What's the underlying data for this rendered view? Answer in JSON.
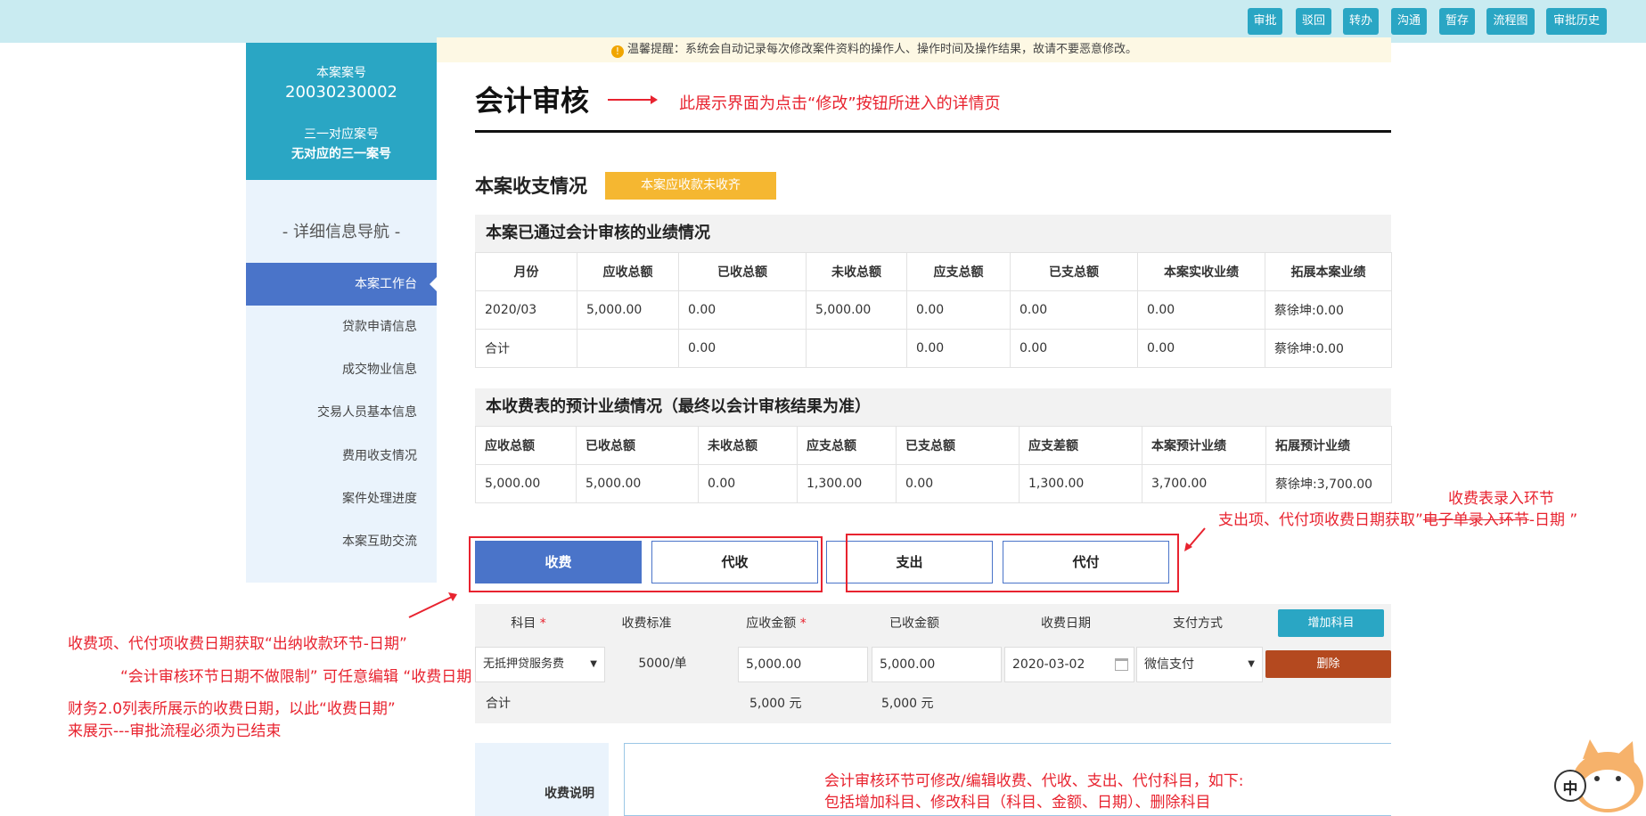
{
  "toolbar": {
    "buttons": [
      "审批",
      "驳回",
      "转办",
      "沟通",
      "暂存",
      "流程图",
      "审批历史"
    ]
  },
  "notice": {
    "icon": "warning-icon",
    "text": "温馨提醒：系统会自动记录每次修改案件资料的操作人、操作时间及操作结果，故请不要恶意修改。"
  },
  "case": {
    "case_no_label": "本案案号",
    "case_no": "20030230002",
    "sanyi_label": "三一对应案号",
    "sanyi_value": "无对应的三一案号"
  },
  "sidebar": {
    "title": "- 详细信息导航 -",
    "items": [
      {
        "label": "本案工作台",
        "active": true
      },
      {
        "label": "贷款申请信息",
        "active": false
      },
      {
        "label": "成交物业信息",
        "active": false
      },
      {
        "label": "交易人员基本信息",
        "active": false
      },
      {
        "label": "费用收支情况",
        "active": false
      },
      {
        "label": "案件处理进度",
        "active": false
      },
      {
        "label": "本案互助交流",
        "active": false
      }
    ]
  },
  "page_title": "会计审核",
  "income_section": {
    "title": "本案收支情况",
    "badge": "本案应收款未收齐"
  },
  "approved_table": {
    "title": "本案已通过会计审核的业绩情况",
    "headers": [
      "月份",
      "应收总额",
      "已收总额",
      "未收总额",
      "应支总额",
      "已支总额",
      "本案实收业绩",
      "拓展本案业绩"
    ],
    "rows": [
      [
        "2020/03",
        "5,000.00",
        "0.00",
        "5,000.00",
        "0.00",
        "0.00",
        "0.00",
        "蔡徐坤:0.00"
      ],
      [
        "合计",
        "",
        "0.00",
        "",
        "0.00",
        "0.00",
        "0.00",
        "蔡徐坤:0.00"
      ]
    ]
  },
  "forecast_table": {
    "title": "本收费表的预计业绩情况（最终以会计审核结果为准）",
    "headers": [
      "应收总额",
      "已收总额",
      "未收总额",
      "应支总额",
      "已支总额",
      "应支差额",
      "本案预计业绩",
      "拓展预计业绩"
    ],
    "rows": [
      [
        "5,000.00",
        "5,000.00",
        "0.00",
        "1,300.00",
        "0.00",
        "1,300.00",
        "3,700.00",
        "蔡徐坤:3,700.00"
      ]
    ]
  },
  "tabs": [
    {
      "label": "收费",
      "active": true
    },
    {
      "label": "代收",
      "active": false
    },
    {
      "label": "支出",
      "active": false
    },
    {
      "label": "代付",
      "active": false
    }
  ],
  "fee_table": {
    "headers": {
      "subject": "科目",
      "standard": "收费标准",
      "receivable": "应收金额",
      "received": "已收金额",
      "date": "收费日期",
      "pay_method": "支付方式"
    },
    "required_mark": "*",
    "add_button": "增加科目",
    "row": {
      "subject": "无抵押贷服务费",
      "standard": "5000/单",
      "receivable": "5,000.00",
      "received": "5,000.00",
      "date": "2020-03-02",
      "pay_method": "微信支付",
      "delete_button": "删除"
    },
    "total": {
      "label": "合计",
      "receivable": "5,000 元",
      "received": "5,000 元"
    }
  },
  "description": {
    "label": "收费说明"
  },
  "annotations": {
    "detail_page": "此展示界面为点击“修改”按钮所进入的详情页",
    "fee_date_source": "收费项、代付项收费日期获取“出纳收款环节-日期”",
    "no_limit": "“会计审核环节日期不做限制” 可任意编辑 “收费日期",
    "finance_line1": "财务2.0列表所展示的收费日期，以此“收费日期”",
    "finance_line2": "来展示---审批流程必须为已结束",
    "fee_entry": "收费表录入环节",
    "expense_date_prefix": "支出项、代付项收费日期获取”",
    "expense_date_strike": "电子单录入环节",
    "expense_date_suffix": "-日期 ”",
    "edit_line1": "会计审核环节可修改/编辑收费、代收、支出、代付科目，如下:",
    "edit_line2": "包括增加科目、修改科目（科目、金额、日期）、删除科目"
  },
  "mascot": {
    "text": "中",
    "icon": "cat-mascot-icon"
  }
}
